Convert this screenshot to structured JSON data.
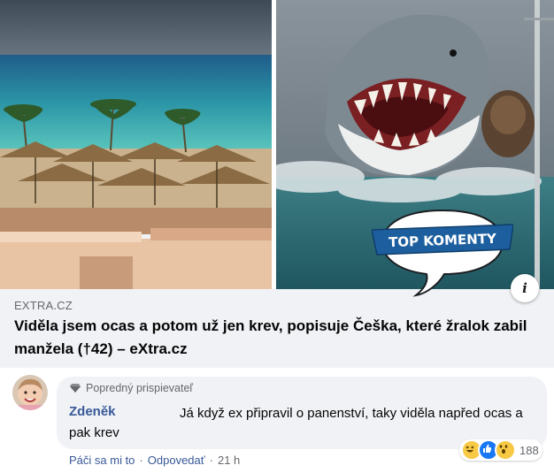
{
  "link_preview": {
    "domain": "EXTRA.CZ",
    "title": "Viděla jsem ocas a potom už jen krev, popisuje Češka, které žralok zabil manžela (†42) – eXtra.cz",
    "sticker_text": "TOP KOMENTY",
    "info_icon": "info-icon",
    "left_image": "beach-with-palm-parasols",
    "right_image": "great-white-shark-attack"
  },
  "comment": {
    "badge": "Popredný prispievateľ",
    "badge_icon": "diamond-icon",
    "author": "Zdeněk",
    "text": "Já když ex připravil o panenství, taky viděla napřed ocas a pak krev",
    "reactions": [
      "haha",
      "like",
      "wow"
    ],
    "reaction_count": "188",
    "actions": {
      "like": "Páči sa mi to",
      "reply": "Odpovedať",
      "time": "21 h",
      "separator": "·"
    }
  },
  "colors": {
    "link": "#385898",
    "muted": "#65676b",
    "bubble": "#f0f2f5",
    "sticker": "#1d5f9e"
  }
}
